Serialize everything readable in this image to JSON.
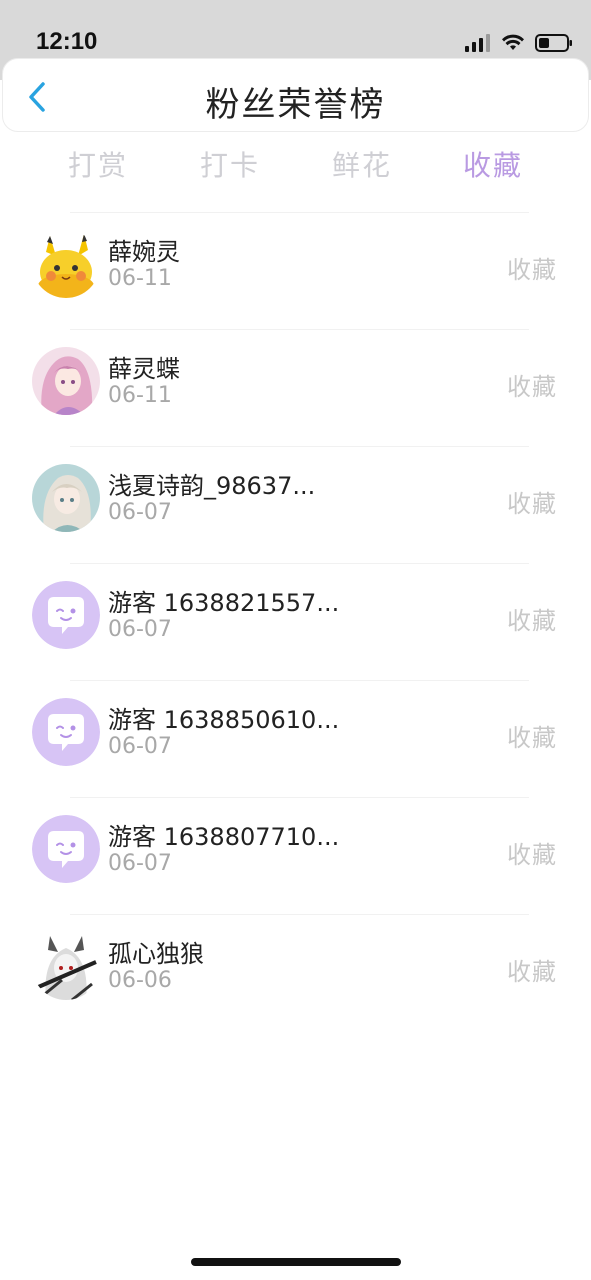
{
  "status_bar": {
    "time": "12:10"
  },
  "header": {
    "title": "粉丝荣誉榜"
  },
  "tabs": [
    {
      "label": "打赏",
      "active": false
    },
    {
      "label": "打卡",
      "active": false
    },
    {
      "label": "鲜花",
      "active": false
    },
    {
      "label": "收藏",
      "active": true
    }
  ],
  "list": [
    {
      "name": "薛婉灵",
      "date": "06-11",
      "action": "收藏",
      "avatar": "pikachu-avatar"
    },
    {
      "name": "薛灵蝶",
      "date": "06-11",
      "action": "收藏",
      "avatar": "anime-girl-pink-avatar"
    },
    {
      "name": "浅夏诗韵_98637...",
      "date": "06-07",
      "action": "收藏",
      "avatar": "anime-girl-teal-avatar"
    },
    {
      "name": "游客 1638821557...",
      "date": "06-07",
      "action": "收藏",
      "avatar": "guest-chat-avatar"
    },
    {
      "name": "游客 1638850610...",
      "date": "06-07",
      "action": "收藏",
      "avatar": "guest-chat-avatar"
    },
    {
      "name": "游客 1638807710...",
      "date": "06-07",
      "action": "收藏",
      "avatar": "guest-chat-avatar"
    },
    {
      "name": "孤心独狼",
      "date": "06-06",
      "action": "收藏",
      "avatar": "anime-wolf-girl-avatar"
    }
  ],
  "colors": {
    "active_tab": "#b99ae2",
    "inactive_tab": "#cfcfd4",
    "back_arrow": "#29a3e0",
    "guest_avatar_bg": "#d7c4f5"
  }
}
